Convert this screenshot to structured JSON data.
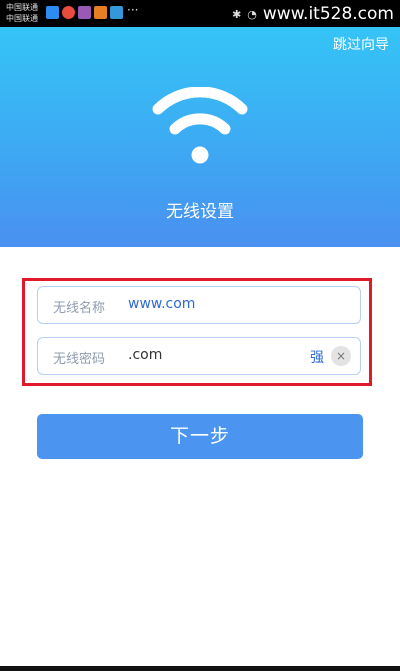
{
  "status_bar": {
    "carrier_1": "中国联通",
    "carrier_2": "中国联通",
    "more": "···",
    "site": "www.it528.com",
    "icons": [
      "app-icon-1",
      "app-icon-2",
      "app-icon-3",
      "app-icon-4",
      "app-icon-5"
    ]
  },
  "header": {
    "skip_label": "跳过向导",
    "title": "无线设置"
  },
  "form": {
    "ssid_label": "无线名称",
    "ssid_value": "www.com",
    "password_label": "无线密码",
    "password_value": ".com",
    "strength": "强",
    "clear_glyph": "×"
  },
  "actions": {
    "next_label": "下一步"
  },
  "colors": {
    "header_top": "#35c4f6",
    "header_bottom": "#4a90f0",
    "button": "#4b95f0",
    "highlight": "#e01a2a",
    "link_blue": "#2f6ad6"
  }
}
